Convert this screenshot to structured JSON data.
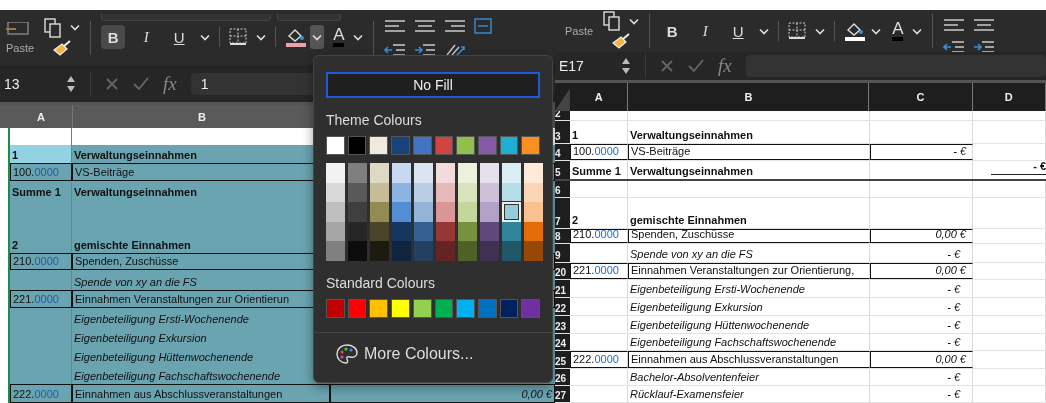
{
  "left_window": {
    "ribbon": {
      "paste_label": "Paste",
      "bold": "B",
      "bold_pressed": true,
      "italic": "I",
      "underline": "U",
      "font_colour_letter": "A",
      "fill_bar": {
        "color": "#e8a2a8"
      },
      "fill_menu_open": true
    },
    "formula_bar": {
      "name_box": "13",
      "function_label": "fx",
      "value": "1"
    },
    "columns": [
      "A",
      "B"
    ],
    "rows": [
      {
        "kind": "blank",
        "selected": false,
        "active": false
      },
      {
        "kind": "heading",
        "a": "1",
        "b": "Verwaltungseinnahmen",
        "selected": true,
        "active": true
      },
      {
        "kind": "account",
        "code": "100.",
        "decimals": "0000",
        "b": "VS-Beiträge",
        "selected": true,
        "active": false
      },
      {
        "kind": "heading",
        "a": "Summe 1",
        "b": "Verwaltungseinnahmen",
        "selected": true,
        "active": false
      },
      {
        "kind": "blank",
        "selected": true,
        "active": false
      },
      {
        "kind": "heading",
        "a": "2",
        "b": "gemischte Einnahmen",
        "selected": true,
        "active": false
      },
      {
        "kind": "account",
        "code": "210.",
        "decimals": "0000",
        "b": "Spenden, Zuschüsse",
        "selected": true,
        "active": false
      },
      {
        "kind": "item",
        "b": "Spende von xy an die FS",
        "selected": true,
        "active": false
      },
      {
        "kind": "account",
        "code": "221.",
        "decimals": "0000",
        "b": "Einnahmen Veranstaltungen zur Orientierun",
        "selected": true,
        "active": false
      },
      {
        "kind": "item",
        "b": "Eigenbeteiligung Ersti-Wochenende",
        "selected": true,
        "active": false
      },
      {
        "kind": "item",
        "b": "Eigenbeteiligung Exkursion",
        "selected": true,
        "active": false
      },
      {
        "kind": "item",
        "b": "Eigenbeteiligung Hüttenwochenende",
        "selected": true,
        "active": false
      },
      {
        "kind": "item",
        "b": "Eigenbeteiligung Fachschaftswochenende",
        "selected": true,
        "active": false
      },
      {
        "kind": "account",
        "code": "222.",
        "decimals": "0000",
        "b": "Einnahmen aus Abschlussveranstaltungen",
        "c": "0,00 €",
        "selected": true,
        "active": false
      }
    ]
  },
  "fill_menu": {
    "no_fill": "No Fill",
    "theme_title": "Theme Colours",
    "theme_colours": [
      {
        "color": "#ffffff"
      },
      {
        "color": "#000000"
      },
      {
        "color": "#eeeadd"
      },
      {
        "color": "#17427a"
      },
      {
        "color": "#4175c2"
      },
      {
        "color": "#d04543"
      },
      {
        "color": "#8fc14a"
      },
      {
        "color": "#8659a6"
      },
      {
        "color": "#1eaed0"
      },
      {
        "color": "#f8901f"
      }
    ],
    "shades": [
      [
        {
          "color": "#f2f2f2",
          "selected": false
        },
        {
          "color": "#d9d9d9",
          "selected": false
        },
        {
          "color": "#bfbfbf",
          "selected": false
        },
        {
          "color": "#a6a6a6",
          "selected": false
        },
        {
          "color": "#808080",
          "selected": false
        }
      ],
      [
        {
          "color": "#7f7f7f",
          "selected": false
        },
        {
          "color": "#595959",
          "selected": false
        },
        {
          "color": "#3f3f3f",
          "selected": false
        },
        {
          "color": "#262626",
          "selected": false
        },
        {
          "color": "#0d0d0d",
          "selected": false
        }
      ],
      [
        {
          "color": "#ddd9c3",
          "selected": false
        },
        {
          "color": "#c4bd97",
          "selected": false
        },
        {
          "color": "#948a54",
          "selected": false
        },
        {
          "color": "#4a452a",
          "selected": false
        },
        {
          "color": "#1d1b10",
          "selected": false
        }
      ],
      [
        {
          "color": "#c6d9f0",
          "selected": false
        },
        {
          "color": "#8db3e2",
          "selected": false
        },
        {
          "color": "#548dd4",
          "selected": false
        },
        {
          "color": "#17365d",
          "selected": false
        },
        {
          "color": "#0f243e",
          "selected": false
        }
      ],
      [
        {
          "color": "#dbe5f1",
          "selected": false
        },
        {
          "color": "#b8cce4",
          "selected": false
        },
        {
          "color": "#95b3d7",
          "selected": false
        },
        {
          "color": "#366092",
          "selected": false
        },
        {
          "color": "#244061",
          "selected": false
        }
      ],
      [
        {
          "color": "#f2dcdb",
          "selected": false
        },
        {
          "color": "#e5b9b7",
          "selected": false
        },
        {
          "color": "#d99694",
          "selected": false
        },
        {
          "color": "#953734",
          "selected": false
        },
        {
          "color": "#632423",
          "selected": false
        }
      ],
      [
        {
          "color": "#ebf1dd",
          "selected": false
        },
        {
          "color": "#d7e3bc",
          "selected": false
        },
        {
          "color": "#c3d69b",
          "selected": false
        },
        {
          "color": "#76923c",
          "selected": false
        },
        {
          "color": "#4f6128",
          "selected": false
        }
      ],
      [
        {
          "color": "#e5e0ec",
          "selected": false
        },
        {
          "color": "#ccc1d9",
          "selected": false
        },
        {
          "color": "#b2a2c7",
          "selected": false
        },
        {
          "color": "#5f497a",
          "selected": false
        },
        {
          "color": "#3f3151",
          "selected": false
        }
      ],
      [
        {
          "color": "#dbeef3",
          "selected": false
        },
        {
          "color": "#b7dde8",
          "selected": false
        },
        {
          "color": "#92cddc",
          "selected": true
        },
        {
          "color": "#31859b",
          "selected": false
        },
        {
          "color": "#205867",
          "selected": false
        }
      ],
      [
        {
          "color": "#fdeada",
          "selected": false
        },
        {
          "color": "#fbd5b5",
          "selected": false
        },
        {
          "color": "#fac08f",
          "selected": false
        },
        {
          "color": "#e36c09",
          "selected": false
        },
        {
          "color": "#974806",
          "selected": false
        }
      ]
    ],
    "standard_title": "Standard Colours",
    "standard_colours": [
      {
        "color": "#c00000"
      },
      {
        "color": "#ff0000"
      },
      {
        "color": "#ffc000"
      },
      {
        "color": "#ffff00"
      },
      {
        "color": "#92d050"
      },
      {
        "color": "#00b050"
      },
      {
        "color": "#00b0f0"
      },
      {
        "color": "#0070c0"
      },
      {
        "color": "#002060"
      },
      {
        "color": "#7030a0"
      }
    ],
    "more": "More Colours..."
  },
  "right_window": {
    "ribbon": {
      "paste_label": "Paste",
      "bold": "B",
      "bold_pressed": false,
      "italic": "I",
      "underline": "U",
      "font_colour_letter": "A",
      "fill_bar": {
        "color": "#ffffff"
      },
      "fill_menu_open": false
    },
    "formula_bar": {
      "name_box": "E17",
      "function_label": "fx"
    },
    "columns": [
      "A",
      "B",
      "C",
      "D"
    ],
    "rows": [
      {
        "header": "2",
        "kind": "blank"
      },
      {
        "header": "3",
        "kind": "heading",
        "a": "1",
        "b": "Verwaltungseinnahmen"
      },
      {
        "header": "4",
        "kind": "account",
        "code": "100.",
        "decimals": "0000",
        "b": "VS-Beiträge",
        "c": "-   €"
      },
      {
        "header": "5",
        "kind": "sum",
        "a": "Summe 1",
        "b": "Verwaltungseinnahmen",
        "d": "-   €"
      },
      {
        "header": "6",
        "kind": "blank"
      },
      {
        "header": "7",
        "kind": "heading",
        "a": "2",
        "b": "gemischte Einnahmen"
      },
      {
        "header": "8",
        "kind": "account",
        "code": "210.",
        "decimals": "0000",
        "b": "Spenden, Zuschüsse",
        "c": "0,00 €"
      },
      {
        "header": "9",
        "kind": "item",
        "b": "Spende von xy an die FS",
        "c": "- €"
      },
      {
        "header": "20",
        "kind": "account",
        "code": "221.",
        "decimals": "0000",
        "b": "Einnahmen Veranstaltungen zur Orientierung,",
        "c": "0,00 €"
      },
      {
        "header": "21",
        "kind": "item",
        "b": "Eigenbeteiligung Ersti-Wochenende",
        "c": "- €"
      },
      {
        "header": "22",
        "kind": "item",
        "b": "Eigenbeteiligung Exkursion",
        "c": "- €"
      },
      {
        "header": "23",
        "kind": "item",
        "b": "Eigenbeteiligung Hüttenwochenende",
        "c": "- €"
      },
      {
        "header": "24",
        "kind": "item",
        "b": "Eigenbeteiligung Fachschaftswochenende",
        "c": "- €"
      },
      {
        "header": "25",
        "kind": "account",
        "code": "222.",
        "decimals": "0000",
        "b": "Einnahmen aus Abschlussveranstaltungen",
        "c": "0,00 €"
      },
      {
        "header": "26",
        "kind": "item",
        "b": "Bachelor-Absolventenfeier",
        "c": "- €"
      },
      {
        "header": "27",
        "kind": "item",
        "b": "Rücklauf-Examensfeier",
        "c": "- €"
      }
    ]
  }
}
